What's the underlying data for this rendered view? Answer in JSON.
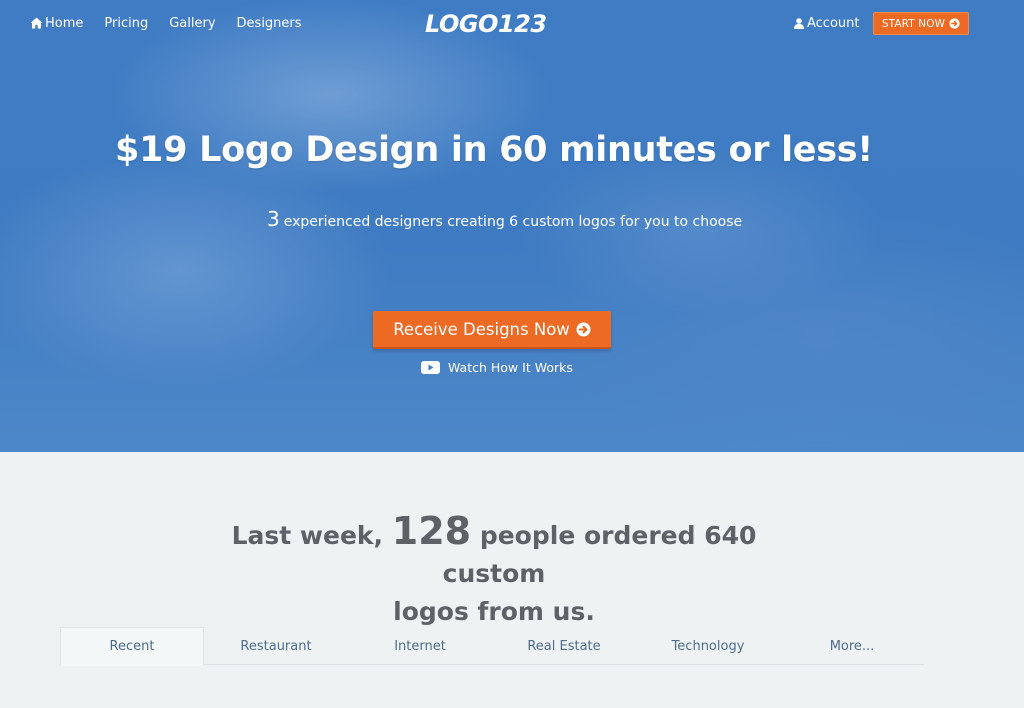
{
  "nav": {
    "links": [
      {
        "label": "Home",
        "icon": "home-icon"
      },
      {
        "label": "Pricing"
      },
      {
        "label": "Gallery"
      },
      {
        "label": "Designers"
      }
    ],
    "logo_text": "LOGO123",
    "account_label": "Account",
    "start_label": "START NOW"
  },
  "hero": {
    "title": "$19 Logo Design in 60 minutes or less!",
    "subtitle_num": "3",
    "subtitle_text": "experienced designers creating 6 custom logos for you to choose",
    "cta_label": "Receive Designs Now",
    "watch_label": "Watch How It Works"
  },
  "stats": {
    "prefix": "Last week,",
    "count": "128",
    "suffix": "people ordered 640 custom",
    "line2": "logos from us."
  },
  "tabs": [
    {
      "label": "Recent",
      "active": true
    },
    {
      "label": "Restaurant"
    },
    {
      "label": "Internet"
    },
    {
      "label": "Real Estate"
    },
    {
      "label": "Technology"
    },
    {
      "label": "More..."
    }
  ],
  "colors": {
    "hero_blue": "#3f7cc4",
    "accent_orange": "#ec6a23",
    "stats_text": "#5d6268",
    "tab_text": "#4f6d8c"
  }
}
